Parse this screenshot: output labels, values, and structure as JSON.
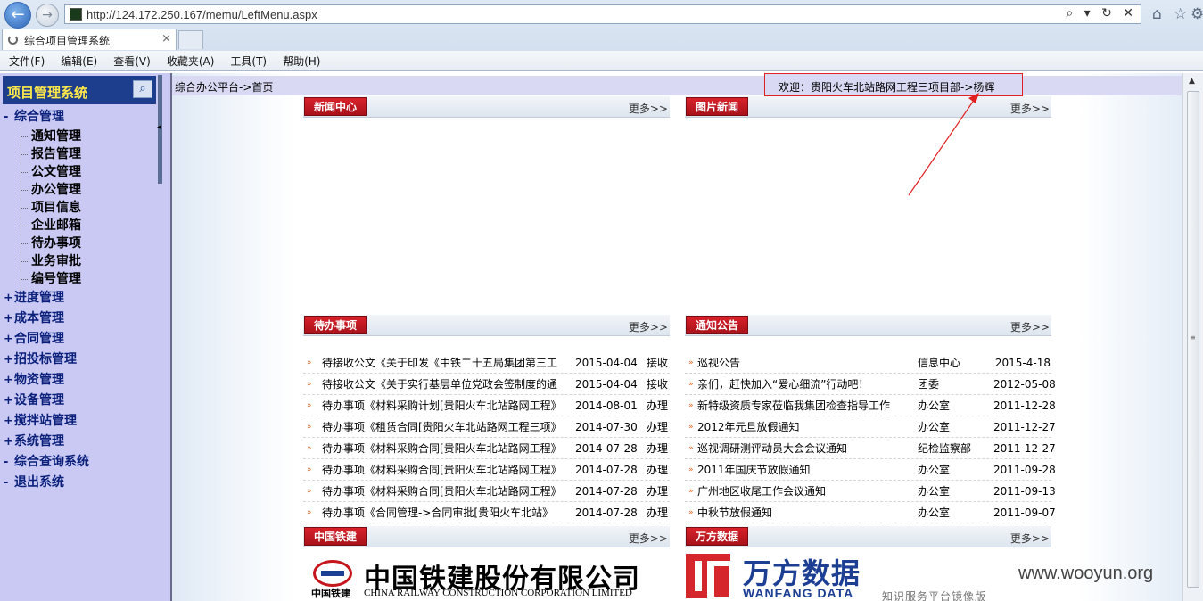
{
  "browser": {
    "url": "http://124.172.250.167/memu/LeftMenu.aspx",
    "address_tools": "⌕ ▾ ↻ ✕",
    "tab_title": "综合项目管理系统",
    "tab_close": "×",
    "back_glyph": "←",
    "forward_glyph": "→",
    "home_glyph": "⌂",
    "star_glyph": "☆",
    "gear_glyph": "⚙",
    "menu": [
      "文件(F)",
      "编辑(E)",
      "查看(V)",
      "收藏夹(A)",
      "工具(T)",
      "帮助(H)"
    ]
  },
  "sidebar": {
    "title": "项目管理系统",
    "search_glyph": "⌕",
    "collapse_glyph": "◂",
    "expanded_sign": "-",
    "collapsed_sign": "+",
    "group_open": "综合管理",
    "sub_items": [
      "通知管理",
      "报告管理",
      "公文管理",
      "办公管理",
      "项目信息",
      "企业邮箱",
      "待办事项",
      "业务审批",
      "编号管理"
    ],
    "groups": [
      "进度管理",
      "成本管理",
      "合同管理",
      "招投标管理",
      "物资管理",
      "设备管理",
      "搅拌站管理",
      "系统管理",
      "综合查询系统",
      "退出系统"
    ]
  },
  "main": {
    "breadcrumb": "综合办公平台->首页",
    "welcome": "欢迎：贵阳火车北站路网工程三项目部->杨辉",
    "more_label": "更多>>",
    "row_arrow": "»",
    "scroll_up": "▲",
    "scroll_grip": "≡",
    "panels": {
      "news": "新闻中心",
      "photo": "图片新闻",
      "todo": "待办事项",
      "notice": "通知公告",
      "crcc": "中国铁建",
      "wanfang": "万方数据"
    },
    "todo_rows": [
      {
        "title": "待接收公文《关于印发《中铁二十五局集团第三工",
        "date": "2015-04-04",
        "action": "接收"
      },
      {
        "title": "待接收公文《关于实行基层单位党政会签制度的通",
        "date": "2015-04-04",
        "action": "接收"
      },
      {
        "title": "待办事项《材料采购计划[贵阳火车北站路网工程》",
        "date": "2014-08-01",
        "action": "办理"
      },
      {
        "title": "待办事项《租赁合同[贵阳火车北站路网工程三项》",
        "date": "2014-07-30",
        "action": "办理"
      },
      {
        "title": "待办事项《材料采购合同[贵阳火车北站路网工程》",
        "date": "2014-07-28",
        "action": "办理"
      },
      {
        "title": "待办事项《材料采购合同[贵阳火车北站路网工程》",
        "date": "2014-07-28",
        "action": "办理"
      },
      {
        "title": "待办事项《材料采购合同[贵阳火车北站路网工程》",
        "date": "2014-07-28",
        "action": "办理"
      },
      {
        "title": "待办事项《合同管理->合同审批[贵阳火车北站》",
        "date": "2014-07-28",
        "action": "办理"
      }
    ],
    "notice_rows": [
      {
        "title": "巡视公告",
        "dept": "信息中心",
        "date": "2015-4-18"
      },
      {
        "title": "亲们，赶快加入“爱心细流”行动吧！",
        "dept": "团委",
        "date": "2012-05-08"
      },
      {
        "title": "新特级资质专家莅临我集团检查指导工作",
        "dept": "办公室",
        "date": "2011-12-28"
      },
      {
        "title": "2012年元旦放假通知",
        "dept": "办公室",
        "date": "2011-12-27"
      },
      {
        "title": "巡视调研测评动员大会会议通知",
        "dept": "纪检监察部",
        "date": "2011-12-27"
      },
      {
        "title": "2011年国庆节放假通知",
        "dept": "办公室",
        "date": "2011-09-28"
      },
      {
        "title": "广州地区收尾工作会议通知",
        "dept": "办公室",
        "date": "2011-09-13"
      },
      {
        "title": "中秋节放假通知",
        "dept": "办公室",
        "date": "2011-09-07"
      }
    ],
    "crcc_logo": {
      "cn": "中国铁建股份有限公司",
      "small": "中国铁建",
      "en": "CHINA RAILWAY CONSTRUCTION CORPORATION LIMITED"
    },
    "wanfang_logo": {
      "cn": "万方数据",
      "en": "WANFANG DATA",
      "sub": "知识服务平台镜像版"
    }
  },
  "watermark": "www.wooyun.org",
  "colors": {
    "accent_red": "#c4161c",
    "sidebar_bg": "#c9c9f4",
    "sidebar_header": "#1d3e8c",
    "annotation": "#e02020"
  }
}
